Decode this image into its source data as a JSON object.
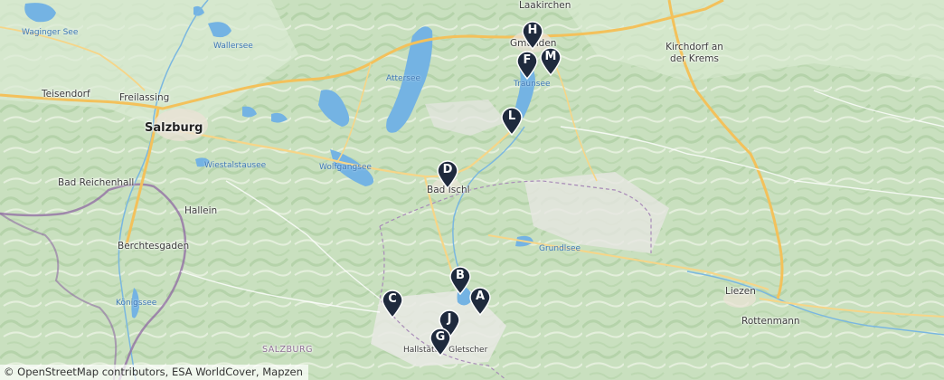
{
  "places": {
    "salzburg": "Salzburg",
    "freilassing": "Freilassing",
    "teisendorf": "Teisendorf",
    "waginger_see": "Waginger See",
    "wallersee": "Wallersee",
    "attersee": "Attersee",
    "wolfgangsee": "Wolfgangsee",
    "wiestalstausee": "Wiestalstausee",
    "bad_reichenhall": "Bad Reichenhall",
    "hallein": "Hallein",
    "berchtesgaden": "Berchtesgaden",
    "koenigssee": "Königssee",
    "bad_ischl": "Bad Ischl",
    "gmunden": "Gmunden",
    "laakirchen": "Laakirchen",
    "traunsee": "Traunsee",
    "kirchdorf": "Kirchdorf an der Krems",
    "grundlsee": "Grundlsee",
    "liezen": "Liezen",
    "rottenmann": "Rottenmann",
    "salzburg_region": "SALZBURG",
    "hallstaetter_gletscher": "Hallstätter Gletscher"
  },
  "markers": [
    {
      "letter": "H"
    },
    {
      "letter": "F"
    },
    {
      "letter": "M"
    },
    {
      "letter": "L"
    },
    {
      "letter": "D"
    },
    {
      "letter": "B"
    },
    {
      "letter": "A"
    },
    {
      "letter": "C"
    },
    {
      "letter": "J"
    },
    {
      "letter": "G"
    }
  ],
  "attribution": "© OpenStreetMap contributors, ESA WorldCover, Mapzen",
  "colors": {
    "marker": "#1f2a3d",
    "water": "#74b3e3",
    "major_road": "#f3c15b",
    "border": "#8f6aa3",
    "land": "#cfe3c6"
  }
}
